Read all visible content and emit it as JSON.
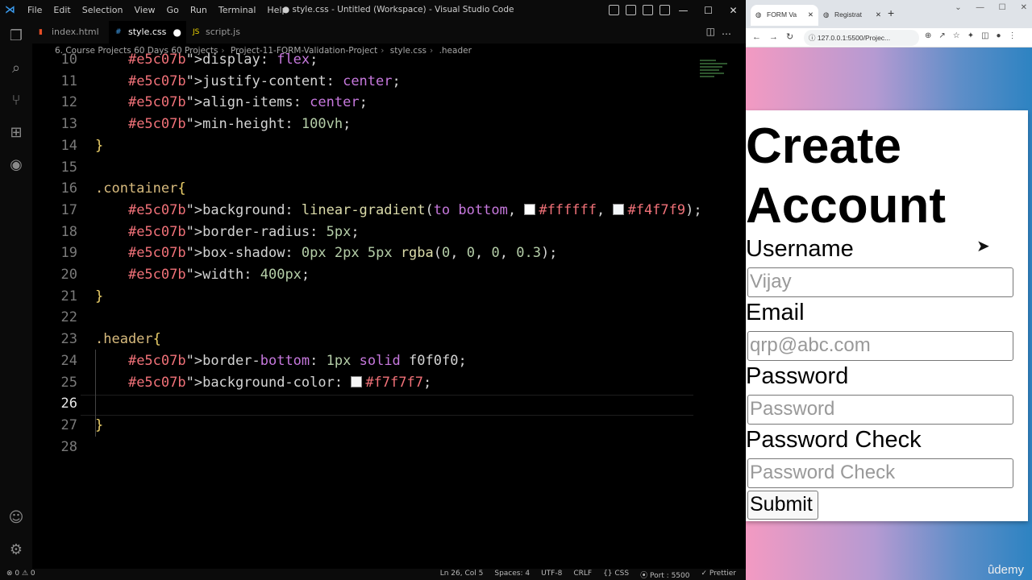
{
  "vscode": {
    "menu": [
      "File",
      "Edit",
      "Selection",
      "View",
      "Go",
      "Run",
      "Terminal",
      "Help"
    ],
    "window_title": "● style.css - Untitled (Workspace) - Visual Studio Code",
    "tabs": [
      {
        "label": "index.html",
        "active": false
      },
      {
        "label": "style.css",
        "active": true,
        "modified": "●"
      },
      {
        "label": "script.js",
        "active": false
      }
    ],
    "breadcrumb": [
      "6. Course Projects 60 Days 60 Projects",
      "Project-11-FORM-Validation-Project",
      "style.css",
      ".header"
    ],
    "lines": [
      {
        "n": "10",
        "text": "    display: flex;"
      },
      {
        "n": "11",
        "text": "    justify-content: center;"
      },
      {
        "n": "12",
        "text": "    align-items: center;"
      },
      {
        "n": "13",
        "text": "    min-height: 100vh;"
      },
      {
        "n": "14",
        "text": "}"
      },
      {
        "n": "15",
        "text": ""
      },
      {
        "n": "16",
        "text": ".container{"
      },
      {
        "n": "17",
        "text": "    background: linear-gradient(to bottom, #ffffff, #f4f7f9);"
      },
      {
        "n": "18",
        "text": "    border-radius: 5px;"
      },
      {
        "n": "19",
        "text": "    box-shadow: 0px 2px 5px rgba(0, 0, 0, 0.3);"
      },
      {
        "n": "20",
        "text": "    width: 400px;"
      },
      {
        "n": "21",
        "text": "}"
      },
      {
        "n": "22",
        "text": ""
      },
      {
        "n": "23",
        "text": ".header{"
      },
      {
        "n": "24",
        "text": "    border-bottom: 1px solid f0f0f0;"
      },
      {
        "n": "25",
        "text": "    background-color: #f7f7f7;"
      },
      {
        "n": "26",
        "text": ""
      },
      {
        "n": "27",
        "text": "}"
      },
      {
        "n": "28",
        "text": ""
      }
    ],
    "status": {
      "left": "⊗ 0 ⚠ 0",
      "items": [
        "Ln 26, Col 5",
        "Spaces: 4",
        "UTF-8",
        "CRLF",
        "{} CSS",
        "⦿ Port : 5500",
        "✓ Prettier"
      ]
    }
  },
  "browser": {
    "tabs": [
      {
        "label": "FORM Va",
        "active": true
      },
      {
        "label": "Registrat",
        "active": false
      }
    ],
    "url": "127.0.0.1:5500/Projec...",
    "page": {
      "title_line1": "Create",
      "title_line2": "Account",
      "fields": [
        {
          "label": "Username",
          "placeholder": "Vijay"
        },
        {
          "label": "Email",
          "placeholder": "qrp@abc.com"
        },
        {
          "label": "Password",
          "placeholder": "Password"
        },
        {
          "label": "Password Check",
          "placeholder": "Password Check"
        }
      ],
      "submit": "Submit"
    },
    "watermark": "ûdemy"
  }
}
